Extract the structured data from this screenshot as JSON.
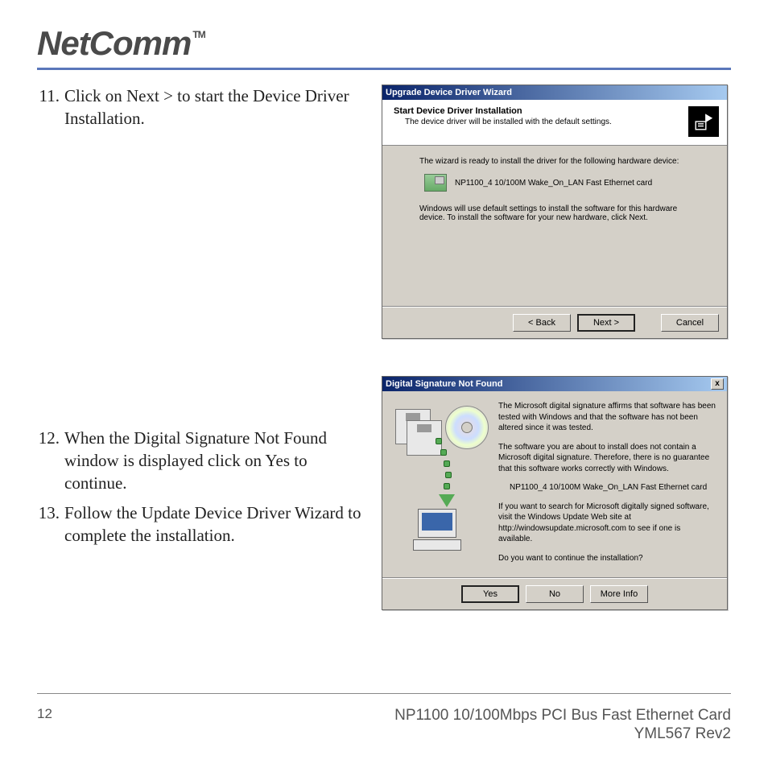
{
  "brand": {
    "name": "NetComm",
    "tm": "TM"
  },
  "steps": [
    {
      "n": "11.",
      "text": "Click on Next > to start the Device Driver Installation."
    },
    {
      "n": "12.",
      "text": "When the Digital Signature Not Found window is displayed click on Yes to continue."
    },
    {
      "n": "13.",
      "text": "Follow the Update Device Driver Wizard to complete the installation."
    }
  ],
  "dialog1": {
    "title": "Upgrade Device Driver Wizard",
    "head_title": "Start Device Driver Installation",
    "head_sub": "The device driver will be installed with the default settings.",
    "body_intro": "The wizard is ready to install the driver for the following hardware device:",
    "device_name": "NP1100_4 10/100M Wake_On_LAN Fast Ethernet card",
    "body_note": "Windows will use default settings to install the software for this hardware device. To install the software for your new hardware, click Next.",
    "btn_back": "< Back",
    "btn_next": "Next >",
    "btn_cancel": "Cancel"
  },
  "dialog2": {
    "title": "Digital Signature Not Found",
    "close": "x",
    "p1": "The Microsoft digital signature affirms that software has been tested with Windows and that the software has not been altered since it was tested.",
    "p2": "The software you are about to install does not contain a Microsoft digital signature. Therefore, there is no guarantee that this software works correctly with Windows.",
    "device_name": "NP1100_4 10/100M Wake_On_LAN Fast Ethernet card",
    "p3": "If you want to search for Microsoft digitally signed software, visit the Windows Update Web site at http://windowsupdate.microsoft.com to see if one is available.",
    "p4": "Do you want to continue the installation?",
    "btn_yes": "Yes",
    "btn_no": "No",
    "btn_more": "More Info"
  },
  "footer": {
    "page": "12",
    "title": "NP1100 10/100Mbps PCI Bus Fast Ethernet Card",
    "rev": "YML567 Rev2"
  }
}
